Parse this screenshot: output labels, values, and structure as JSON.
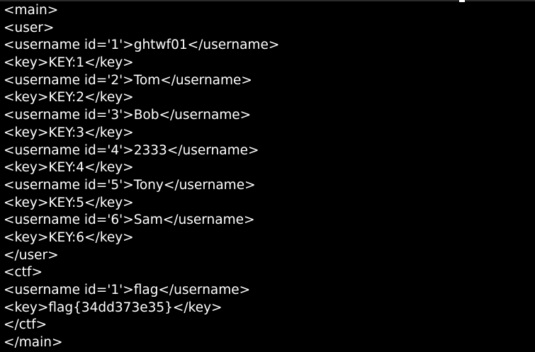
{
  "terminal": {
    "background": "#000000",
    "foreground": "#ffffff",
    "lines": [
      "<main>",
      "<user>",
      "<username id='1'>ghtwf01</username>",
      "<key>KEY:1</key>",
      "<username id='2'>Tom</username>",
      "<key>KEY:2</key>",
      "<username id='3'>Bob</username>",
      "<key>KEY:3</key>",
      "<username id='4'>2333</username>",
      "<key>KEY:4</key>",
      "<username id='5'>Tony</username>",
      "<key>KEY:5</key>",
      "<username id='6'>Sam</username>",
      "<key>KEY:6</key>",
      "</user>",
      "<ctf>",
      "<username id='1'>flag</username>",
      "<key>flag{34dd373e35}</key>",
      "</ctf>",
      "</main>"
    ]
  }
}
